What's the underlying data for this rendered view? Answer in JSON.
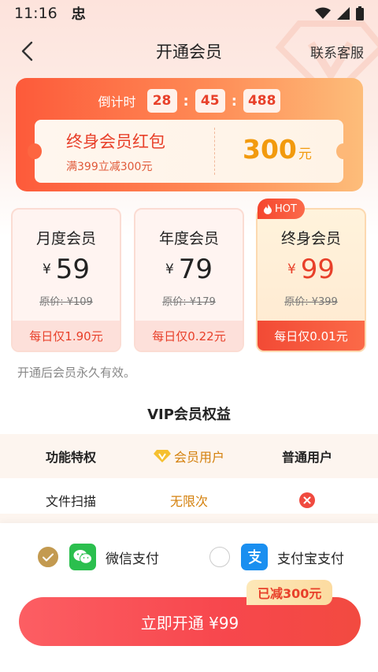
{
  "status": {
    "time": "11:16",
    "app_glyph": "忠"
  },
  "nav": {
    "title": "开通会员",
    "service": "联系客服"
  },
  "promo": {
    "countdown_label": "倒计时",
    "hours": "28",
    "minutes": "45",
    "millis": "488",
    "sep": ":",
    "coupon_title": "终身会员红包",
    "coupon_sub": "满399立减300元",
    "coupon_amount": "300",
    "coupon_unit": "元"
  },
  "plans": [
    {
      "name": "月度会员",
      "currency": "¥",
      "price": "59",
      "original": "原价: ¥109",
      "daily": "每日仅1.90元"
    },
    {
      "name": "年度会员",
      "currency": "¥",
      "price": "79",
      "original": "原价: ¥179",
      "daily": "每日仅0.22元"
    },
    {
      "name": "终身会员",
      "currency": "¥",
      "price": "99",
      "original": "原价: ¥399",
      "daily": "每日仅0.01元",
      "badge": "HOT"
    }
  ],
  "note": "开通后会员永久有效。",
  "benefits": {
    "title": "VIP会员权益",
    "headers": [
      "功能特权",
      "会员用户",
      "普通用户"
    ],
    "rows": [
      {
        "feature": "文件扫描",
        "vip": "无限次",
        "normal_icon": "cross-icon"
      }
    ]
  },
  "payment": {
    "wechat_label": "微信支付",
    "alipay_label": "支付宝支付",
    "selected": "wechat"
  },
  "discount_tag": "已减300元",
  "buy_button": "立即开通 ¥99",
  "colors": {
    "accent": "#e8402a",
    "gold": "#d4800c",
    "wechat": "#2bbf4e",
    "alipay": "#1a8ff0"
  }
}
